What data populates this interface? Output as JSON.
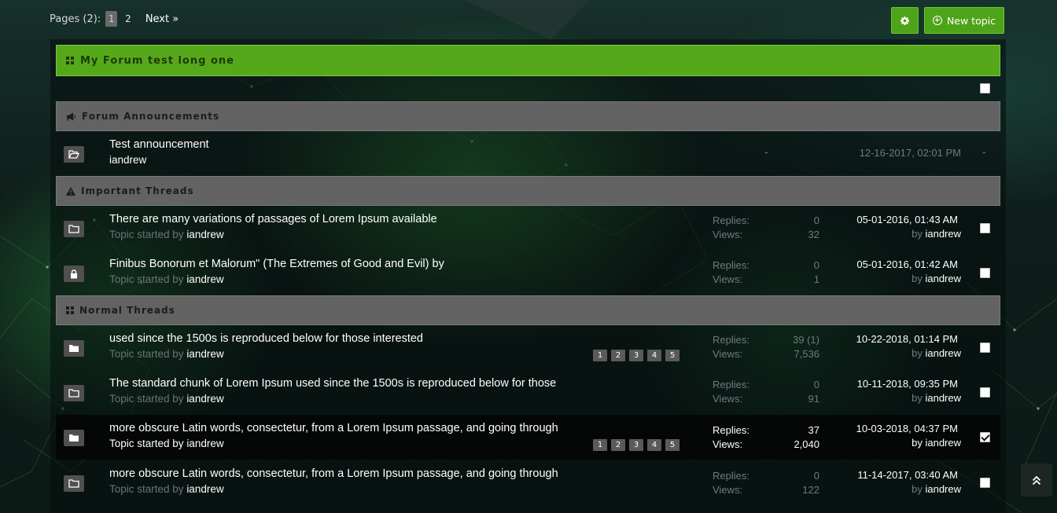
{
  "pagination": {
    "label": "Pages (2):",
    "current": "1",
    "pages": [
      "2"
    ],
    "next": "Next »"
  },
  "toolbar": {
    "new_topic_label": "New topic"
  },
  "forum": {
    "title": "My Forum test long one"
  },
  "sections": {
    "announcements": "Forum Announcements",
    "important": "Important Threads",
    "normal": "Normal Threads"
  },
  "labels": {
    "topic_started_by": "Topic started by",
    "replies": "Replies:",
    "views": "Views:",
    "by": "by"
  },
  "announcement": {
    "title": "Test announcement",
    "author": "iandrew",
    "dash1": "-",
    "date": "12-16-2017, 02:01 PM",
    "dash2": "-"
  },
  "important_threads": [
    {
      "title": "There are many variations of passages of Lorem Ipsum available",
      "author": "iandrew",
      "replies": "0",
      "views": "32",
      "date": "05-01-2016, 01:43 AM",
      "last_by": "iandrew",
      "icon": "folder-icon"
    },
    {
      "title": "Finibus Bonorum et Malorum\" (The Extremes of Good and Evil) by",
      "author": "iandrew",
      "replies": "0",
      "views": "1",
      "date": "05-01-2016, 01:42 AM",
      "last_by": "iandrew",
      "icon": "lock-icon"
    }
  ],
  "normal_threads": [
    {
      "title": "used since the 1500s is reproduced below for those interested",
      "author": "iandrew",
      "replies": "39 (1)",
      "views": "7,536",
      "date": "10-22-2018, 01:14 PM",
      "last_by": "iandrew",
      "pages": [
        "1",
        "2",
        "3",
        "4",
        "5"
      ],
      "icon": "folder-filled-icon",
      "checked": false
    },
    {
      "title": "The standard chunk of Lorem Ipsum used since the 1500s is reproduced below for those",
      "author": "iandrew",
      "replies": "0",
      "views": "91",
      "date": "10-11-2018, 09:35 PM",
      "last_by": "iandrew",
      "icon": "folder-icon",
      "checked": false
    },
    {
      "title": "more obscure Latin words, consectetur, from a Lorem Ipsum passage, and going through",
      "author": "iandrew",
      "replies": "37",
      "views": "2,040",
      "date": "10-03-2018, 04:37 PM",
      "last_by": "iandrew",
      "pages": [
        "1",
        "2",
        "3",
        "4",
        "5"
      ],
      "icon": "folder-filled-icon",
      "checked": true
    },
    {
      "title": "more obscure Latin words, consectetur, from a Lorem Ipsum passage, and going through",
      "author": "iandrew",
      "replies": "0",
      "views": "122",
      "date": "11-14-2017, 03:40 AM",
      "last_by": "iandrew",
      "icon": "folder-icon",
      "checked": false
    }
  ],
  "colors": {
    "accent": "#56a81b",
    "section": "#636363"
  }
}
